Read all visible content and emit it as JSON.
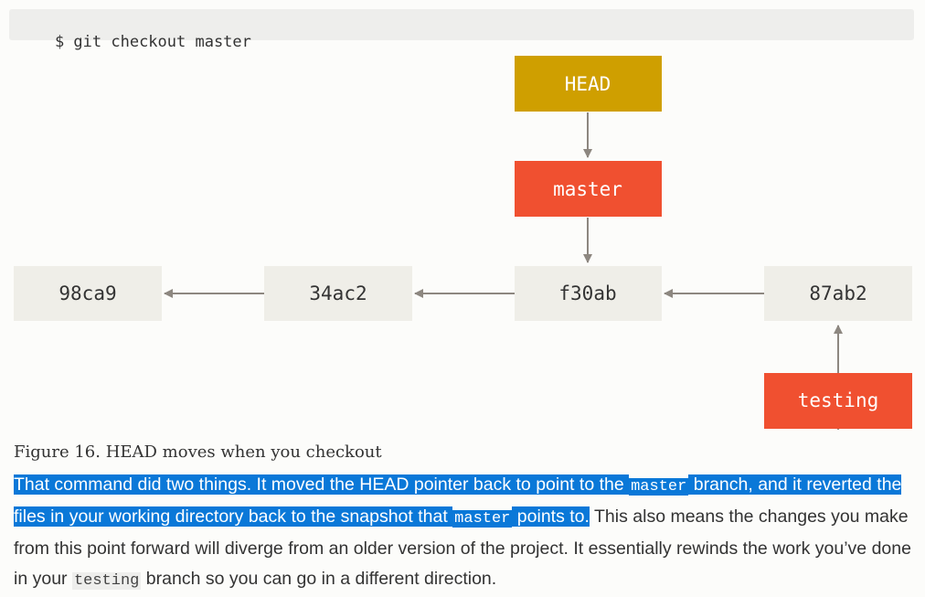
{
  "code_block": {
    "command": "$ git checkout master"
  },
  "diagram": {
    "nodes": {
      "head": "HEAD",
      "master": "master",
      "commit_1": "98ca9",
      "commit_2": "34ac2",
      "commit_3": "f30ab",
      "commit_4": "87ab2",
      "testing": "testing"
    },
    "colors": {
      "head": "#cf9f00",
      "branch": "#f05030",
      "commit": "#efeee8",
      "arrow": "#8d8780",
      "commit_text": "#333333",
      "label_text": "#ffffff"
    }
  },
  "caption": "Figure 16. HEAD moves when you checkout",
  "paragraph": {
    "p1": "That command did two things. It moved the HEAD pointer back to point to the ",
    "code1": "master",
    "p2": " branch, and it reverted the files in your working directory back to the snapshot that ",
    "code2": "master",
    "p3": " points to.",
    "p4": " This also means the changes you make from this point forward will diverge from an older version of the project. It essentially rewinds the work you’ve done in your ",
    "code3": "testing",
    "p5": " branch so you can go in a different direction."
  },
  "selection_color": "#0a78d8"
}
